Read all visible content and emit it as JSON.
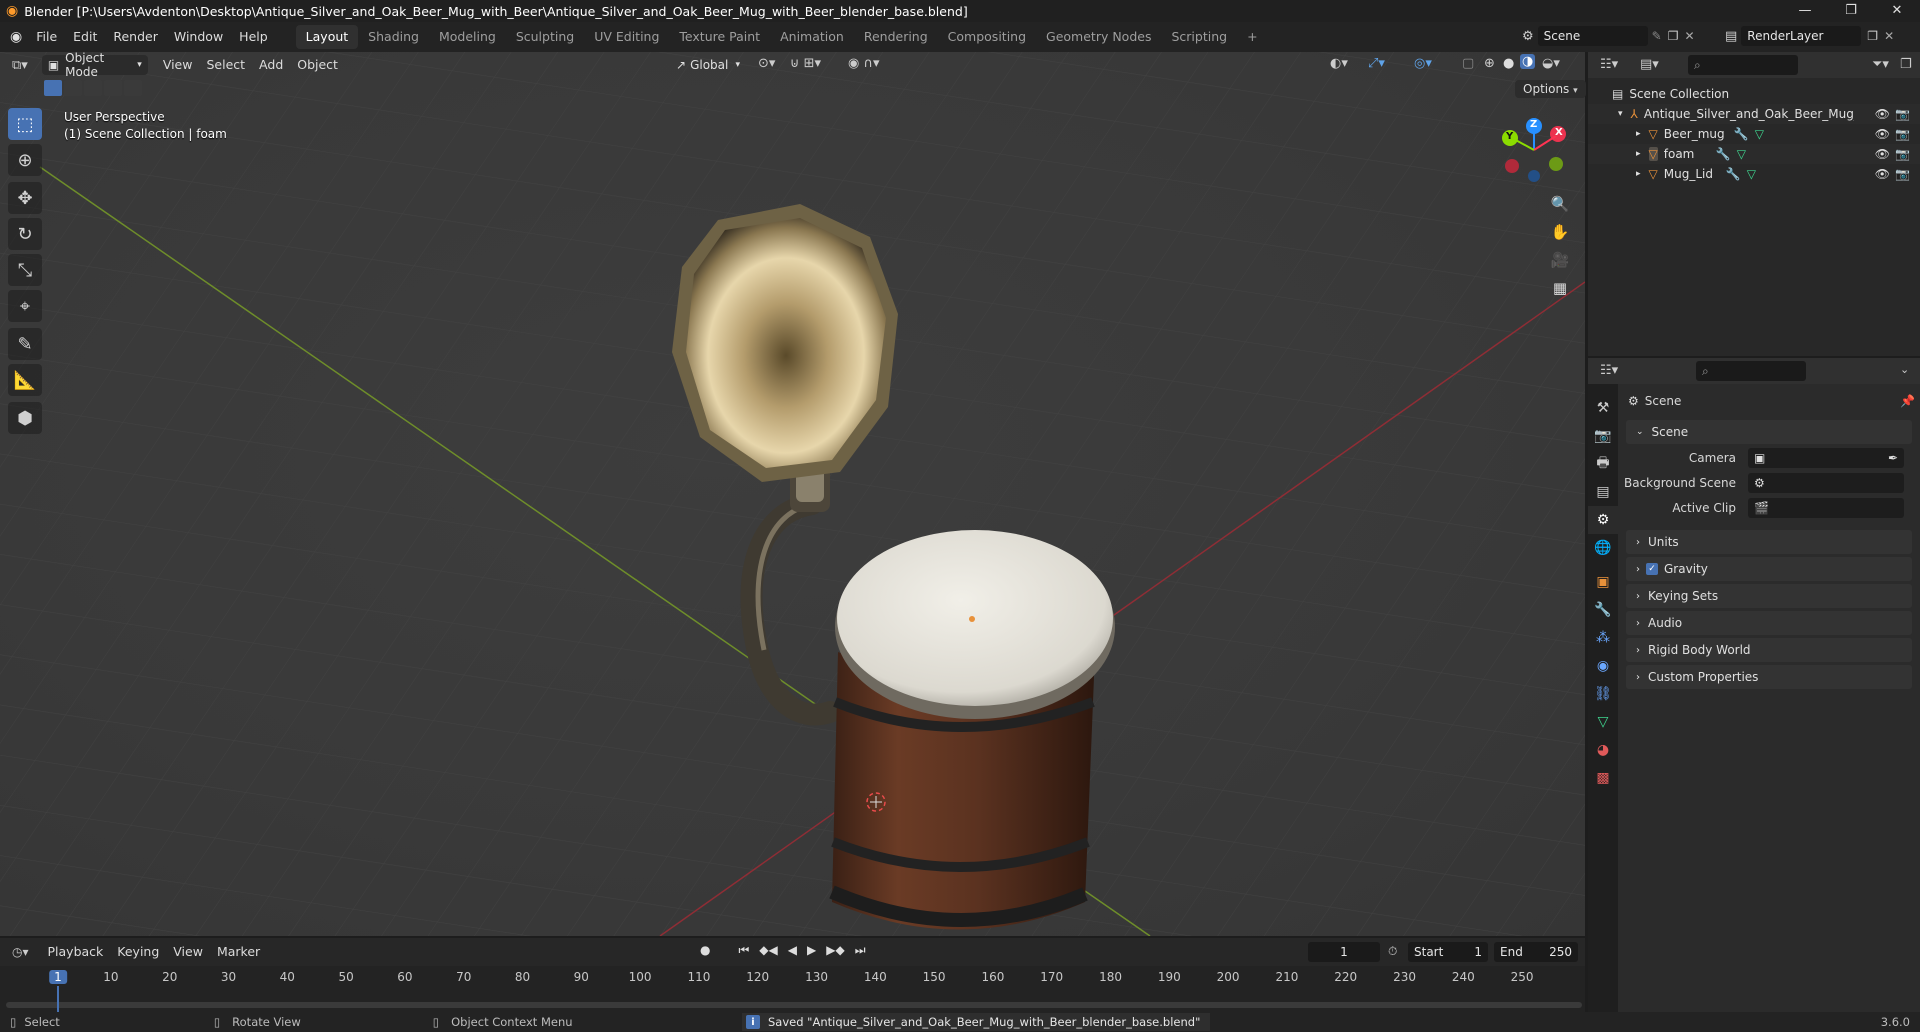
{
  "window": {
    "title": "Blender [P:\\Users\\Avdenton\\Desktop\\Antique_Silver_and_Oak_Beer_Mug_with_Beer\\Antique_Silver_and_Oak_Beer_Mug_with_Beer_blender_base.blend]",
    "controls": [
      "—",
      "❐",
      "✕"
    ]
  },
  "menus": [
    "File",
    "Edit",
    "Render",
    "Window",
    "Help"
  ],
  "workspaces": [
    "Layout",
    "Shading",
    "Modeling",
    "Sculpting",
    "UV Editing",
    "Texture Paint",
    "Animation",
    "Rendering",
    "Compositing",
    "Geometry Nodes",
    "Scripting"
  ],
  "active_workspace": "Layout",
  "add_workspace": "+",
  "scene_selector": {
    "value": "Scene"
  },
  "view_layer_selector": {
    "value": "RenderLayer"
  },
  "viewport": {
    "mode": "Object Mode",
    "menus": [
      "View",
      "Select",
      "Add",
      "Object"
    ],
    "transform_orientation": "Global",
    "options_label": "Options",
    "overlay_line1": "User Perspective",
    "overlay_line2": "(1) Scene Collection | foam",
    "gizmo_axes": {
      "x": "X",
      "y": "Y",
      "z": "Z"
    },
    "tools": [
      "select-box",
      "cursor",
      "move",
      "rotate",
      "scale",
      "transform",
      "annotate",
      "measure",
      "add-cube"
    ],
    "active_tool": "select-box"
  },
  "outliner": {
    "root": "Scene Collection",
    "collection": "Antique_Silver_and_Oak_Beer_Mug_with",
    "objects": [
      {
        "name": "Beer_mug"
      },
      {
        "name": "foam"
      },
      {
        "name": "Mug_Lid"
      }
    ]
  },
  "properties": {
    "context_title": "Scene",
    "scene_panel_title": "Scene",
    "fields": [
      {
        "label": "Camera",
        "value": ""
      },
      {
        "label": "Background Scene",
        "value": ""
      },
      {
        "label": "Active Clip",
        "value": ""
      }
    ],
    "panels": [
      "Units",
      "Gravity",
      "Keying Sets",
      "Audio",
      "Rigid Body World",
      "Custom Properties"
    ],
    "gravity_checked": true
  },
  "timeline": {
    "menus": [
      "Playback",
      "Keying",
      "View",
      "Marker"
    ],
    "current_frame": "1",
    "start_label": "Start",
    "start": "1",
    "end_label": "End",
    "end": "250",
    "ruler": [
      "1",
      "10",
      "20",
      "30",
      "40",
      "50",
      "60",
      "70",
      "80",
      "90",
      "100",
      "110",
      "120",
      "130",
      "140",
      "150",
      "160",
      "170",
      "180",
      "190",
      "200",
      "210",
      "220",
      "230",
      "240",
      "250"
    ]
  },
  "statusbar": {
    "select": "Select",
    "rotate": "Rotate View",
    "context_menu": "Object Context Menu",
    "message": "Saved \"Antique_Silver_and_Oak_Beer_Mug_with_Beer_blender_base.blend\"",
    "version": "3.6.0"
  },
  "colors": {
    "accent": "#4772b3",
    "axis_x": "#ff3352",
    "axis_y": "#8bdc00",
    "axis_z": "#2890ff",
    "object_icon": "#e8913a"
  }
}
